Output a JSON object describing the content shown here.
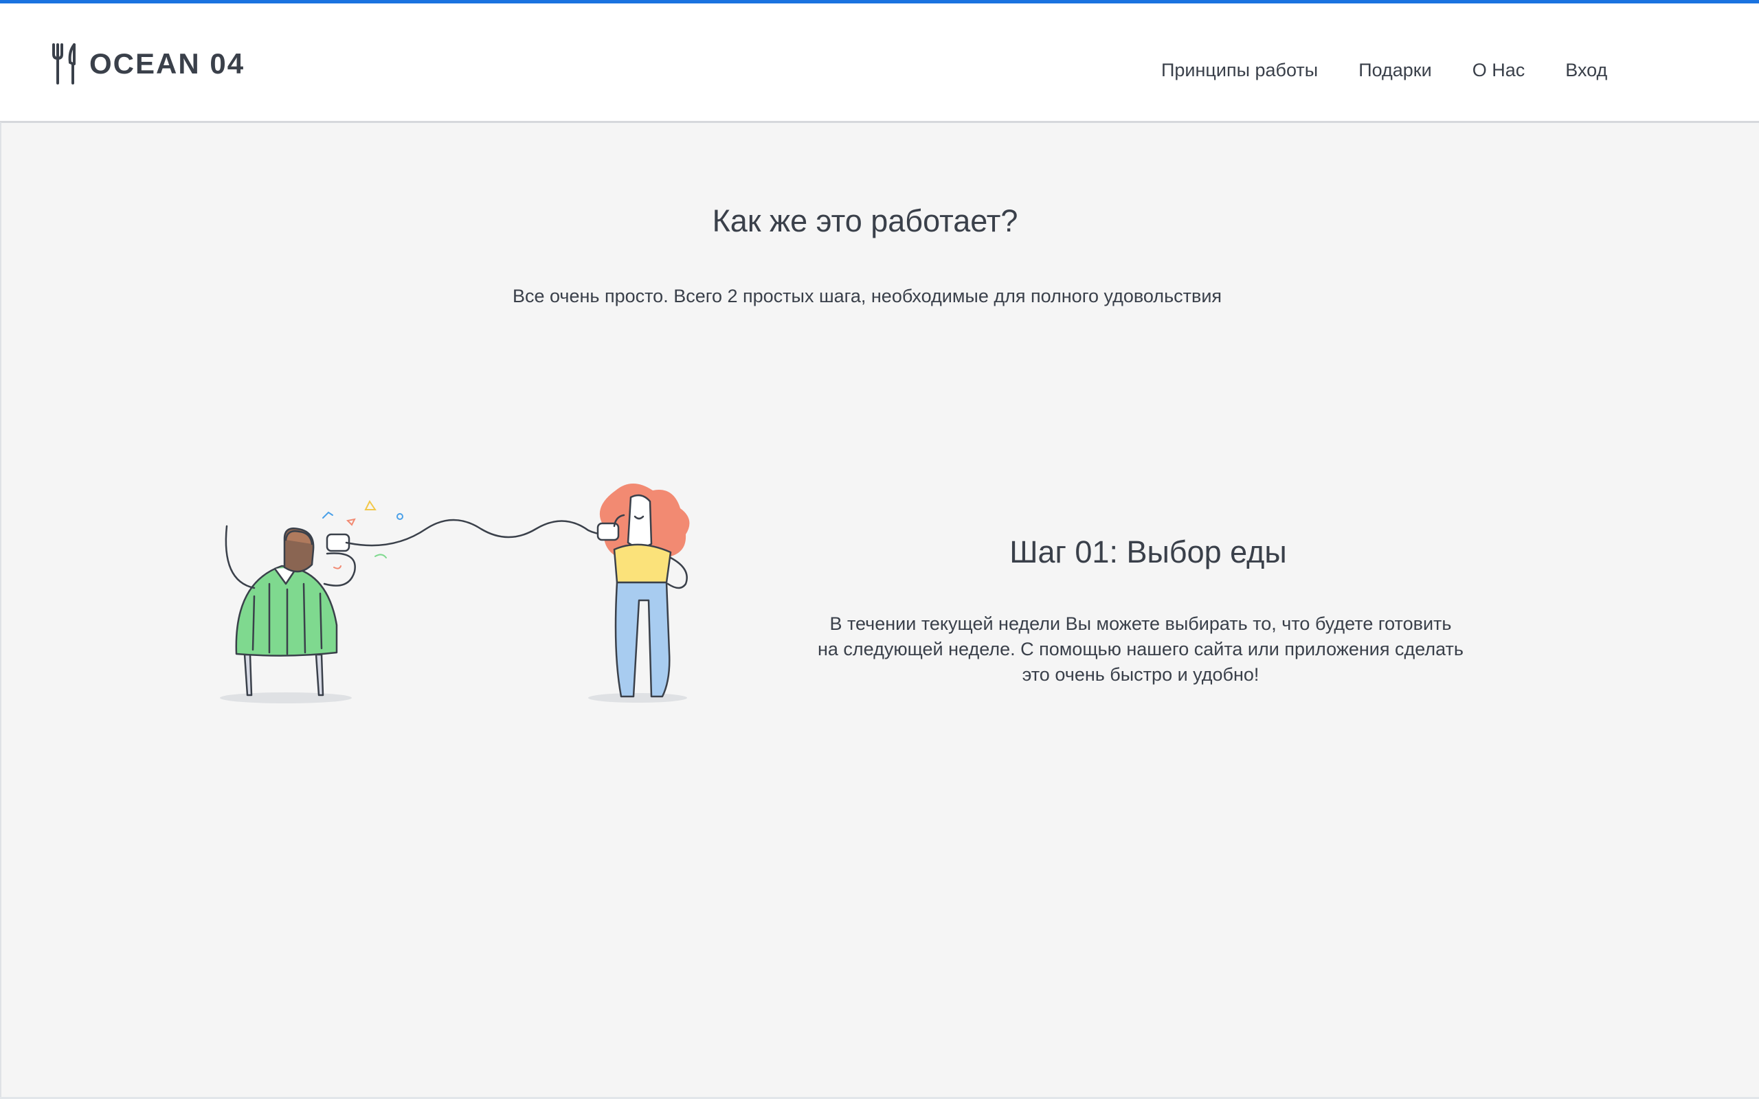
{
  "brand": {
    "logo_icon": "fork-knife-icon",
    "name": "OCEAN 04"
  },
  "nav": {
    "items": [
      "Принципы работы",
      "Подарки",
      "О Нас",
      "Вход"
    ]
  },
  "hero": {
    "title": "Как же это работает?",
    "subtitle": "Все очень просто. Всего 2 простых шага, необходимые для полного удовольствия"
  },
  "step": {
    "illustration_icon": "tin-can-phone-illustration",
    "title": "Шаг 01: Выбор еды",
    "text": "В течении текущей недели Вы можете выбирать то, что будете готовить на следующей неделе. С помощью нашего сайта или приложения сделать это очень быстро и удобно!"
  },
  "colors": {
    "accent": "#1a73e0",
    "text": "#3a404a",
    "background": "#f5f5f5",
    "header_bg": "#ffffff",
    "sweater": "#7fd98f",
    "hair": "#f28a72",
    "top": "#fbe27a",
    "jeans": "#a8ccf0"
  }
}
